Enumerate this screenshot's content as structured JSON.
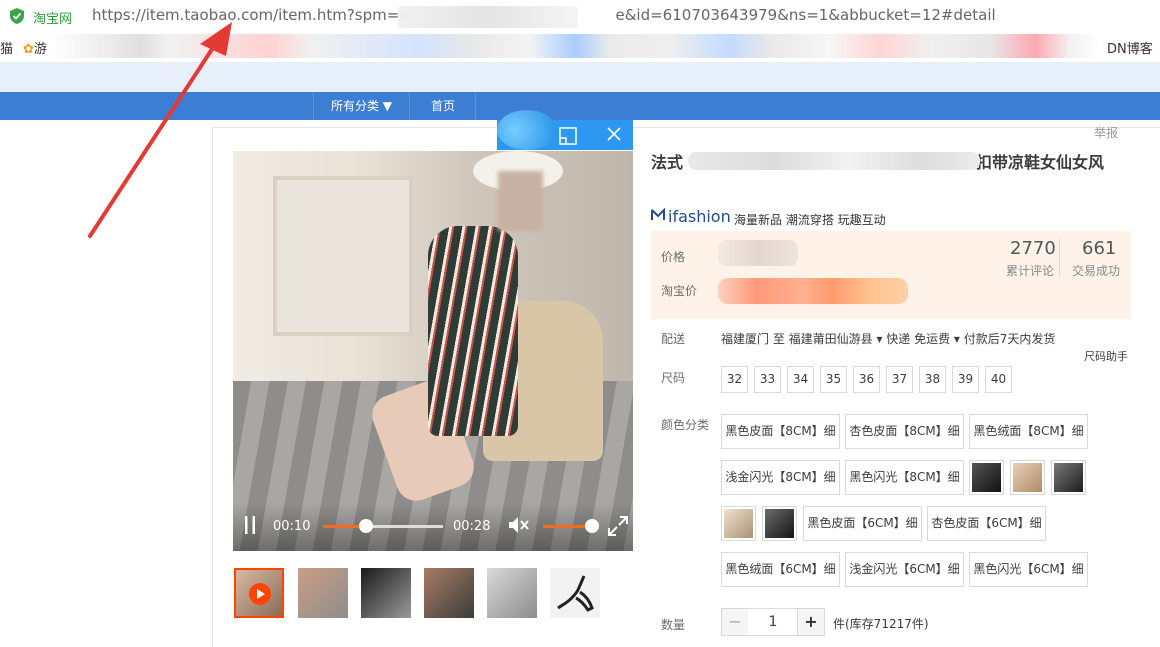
{
  "browser": {
    "site_badge": "淘宝网",
    "url": "https://item.taobao.com/item.htm?spm=a",
    "url_tail": "e&id=610703643979&ns=1&abbucket=12#detail",
    "bookmark_first": "猫",
    "bookmark_second": "游",
    "bookmark_tail": "DN博客"
  },
  "nav": {
    "all_categories": "所有分类 ▼",
    "home": "首页"
  },
  "page": {
    "report": "举报"
  },
  "video": {
    "current_time": "00:10",
    "duration": "00:28",
    "progress_fraction": 0.357,
    "volume_fraction": 1.0
  },
  "product": {
    "title_start": "法式",
    "title_end": "扣带凉鞋女仙女风",
    "brand": "ifashion",
    "tagline": "海量新品 潮流穿搭 玩趣互动",
    "price_label": "价格",
    "taobao_price_label": "淘宝价",
    "review_count": "2770",
    "review_label": "累计评论",
    "deal_count": "661",
    "deal_label": "交易成功",
    "ship_label": "配送",
    "ship_text": "福建厦门 至  福建莆田仙游县 ▾  快递 免运费 ▾  付款后7天内发货",
    "size_helper": "尺码助手",
    "size_label": "尺码",
    "sizes": [
      "32",
      "33",
      "34",
      "35",
      "36",
      "37",
      "38",
      "39",
      "40"
    ],
    "color_label": "颜色分类",
    "colors": [
      "黑色皮面【8CM】细",
      "杏色皮面【8CM】细",
      "黑色绒面【8CM】细",
      "浅金闪光【8CM】细",
      "黑色闪光【8CM】细",
      "黑色皮面【6CM】细",
      "杏色皮面【6CM】细",
      "黑色绒面【6CM】细",
      "浅金闪光【6CM】细",
      "黑色闪光【6CM】细"
    ],
    "qty_label": "数量",
    "qty_minus": "−",
    "qty_value": "1",
    "qty_plus": "+",
    "stock_text": "件(库存71217件)"
  },
  "colors": {
    "nav_blue": "#3d7ed5",
    "accent_orange": "#f40",
    "price_bg": "#fff2e8",
    "annotation_red": "#e53935"
  }
}
